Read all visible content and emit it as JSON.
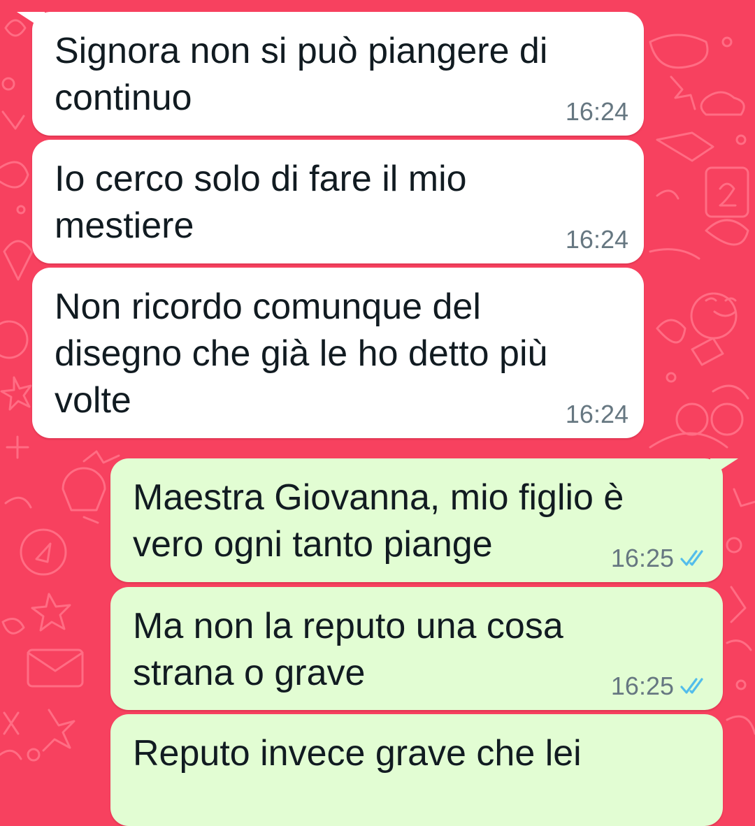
{
  "chat": {
    "theme": {
      "wallpaper_color": "#f7415f",
      "wallpaper_doodle_color": "#ff6d84",
      "incoming_bubble_color": "#ffffff",
      "outgoing_bubble_color": "#e2fdd3",
      "read_tick_color": "#53bdeb"
    },
    "messages": [
      {
        "direction": "incoming",
        "lines": [
          "Signora non si può piangere di",
          "continuo"
        ],
        "time": "16:24"
      },
      {
        "direction": "incoming",
        "lines": [
          "Io cerco solo di fare il mio",
          "mestiere"
        ],
        "time": "16:24"
      },
      {
        "direction": "incoming",
        "lines": [
          "Non ricordo comunque del",
          "disegno che già le ho detto più",
          "volte"
        ],
        "time": "16:24"
      },
      {
        "direction": "outgoing",
        "lines": [
          "Maestra Giovanna, mio figlio è",
          "vero ogni tanto piange"
        ],
        "time": "16:25",
        "status": "read",
        "status_icon": "double-check-read-icon"
      },
      {
        "direction": "outgoing",
        "lines": [
          "Ma non la reputo una cosa",
          "strana o grave"
        ],
        "time": "16:25",
        "status": "read",
        "status_icon": "double-check-read-icon"
      },
      {
        "direction": "outgoing",
        "lines": [
          "Reputo invece grave che lei"
        ]
      }
    ]
  }
}
